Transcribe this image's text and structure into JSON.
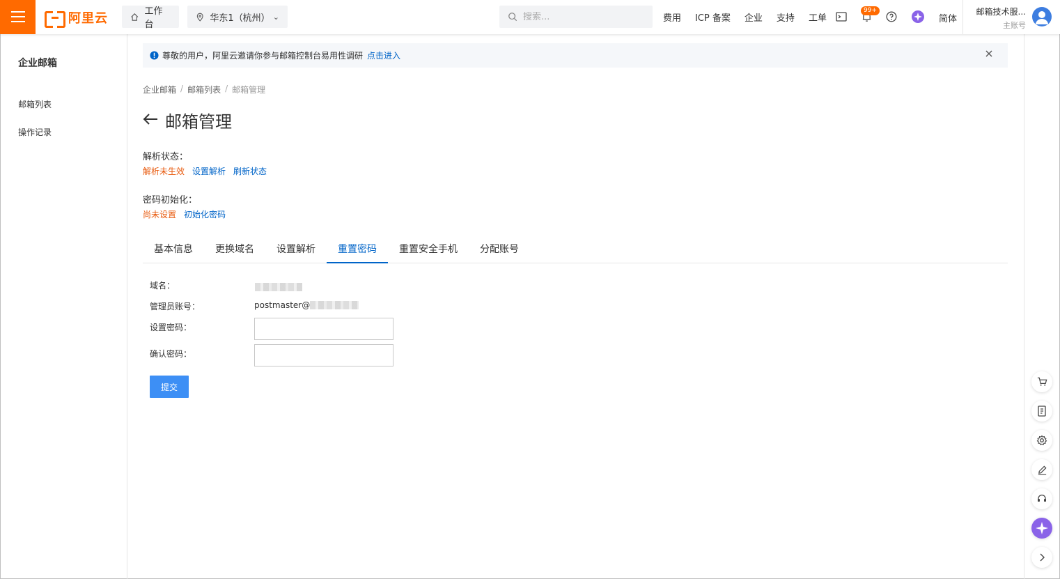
{
  "header": {
    "logo_text": "阿里云",
    "workbench_label": "工作台",
    "region_label": "华东1（杭州）",
    "search_placeholder": "搜索...",
    "nav": [
      "费用",
      "ICP 备案",
      "企业",
      "支持",
      "工单"
    ],
    "notification_badge": "99+",
    "lang": "简体",
    "user_name": "邮箱技术服...",
    "user_role": "主账号"
  },
  "sidebar": {
    "title": "企业邮箱",
    "items": [
      "邮箱列表",
      "操作记录"
    ]
  },
  "notice": {
    "text": "尊敬的用户，阿里云邀请你参与邮箱控制台易用性调研",
    "link": "点击进入"
  },
  "breadcrumb": [
    "企业邮箱",
    "邮箱列表",
    "邮箱管理"
  ],
  "page_title": "邮箱管理",
  "dns_status": {
    "label": "解析状态：",
    "state": "解析未生效",
    "action1": "设置解析",
    "action2": "刷新状态"
  },
  "password_init": {
    "label": "密码初始化：",
    "state": "尚未设置",
    "action": "初始化密码"
  },
  "tabs": [
    "基本信息",
    "更换域名",
    "设置解析",
    "重置密码",
    "重置安全手机",
    "分配账号"
  ],
  "active_tab": "重置密码",
  "form": {
    "domain_label": "域名：",
    "admin_label": "管理员账号：",
    "admin_prefix": "postmaster@",
    "password_label": "设置密码：",
    "confirm_label": "确认密码：",
    "submit_label": "提交"
  },
  "colors": {
    "brand": "#ff6a00",
    "link": "#0064c8",
    "warning": "#e8590c",
    "primary_button": "#3d8ff5"
  }
}
